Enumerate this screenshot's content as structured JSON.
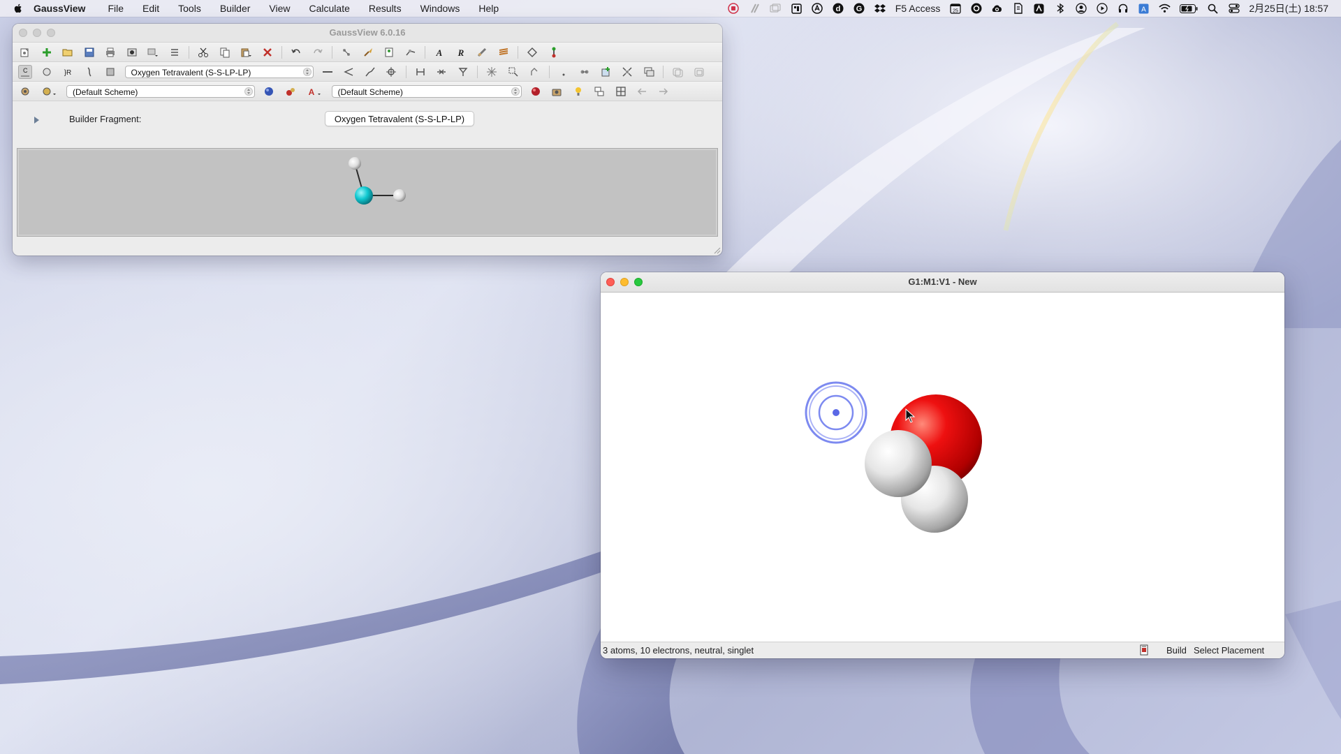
{
  "menubar": {
    "app_name": "GaussView",
    "items": [
      "File",
      "Edit",
      "Tools",
      "Builder",
      "View",
      "Calculate",
      "Results",
      "Windows",
      "Help"
    ],
    "right_label": "F5 Access",
    "calendar_day": "25",
    "datetime": "2月25日(土) 18:57"
  },
  "main_window": {
    "title": "GaussView 6.0.16",
    "fragment_combo": "Oxygen Tetravalent (S-S-LP-LP)",
    "scheme_combo_1": "(Default Scheme)",
    "scheme_combo_2": "(Default Scheme)",
    "builder_label": "Builder Fragment:",
    "fragment_button": "Oxygen Tetravalent (S-S-LP-LP)"
  },
  "molecule_window": {
    "title": "G1:M1:V1 - New",
    "status_text": "3 atoms, 10 electrons, neutral, singlet",
    "mode": "Build",
    "action": "Select Placement"
  },
  "colors": {
    "oxygen": "#e00000",
    "hydrogen": "#e8e8e8",
    "fragment_center": "#10c8d0",
    "target_ring": "#6f7df0"
  }
}
